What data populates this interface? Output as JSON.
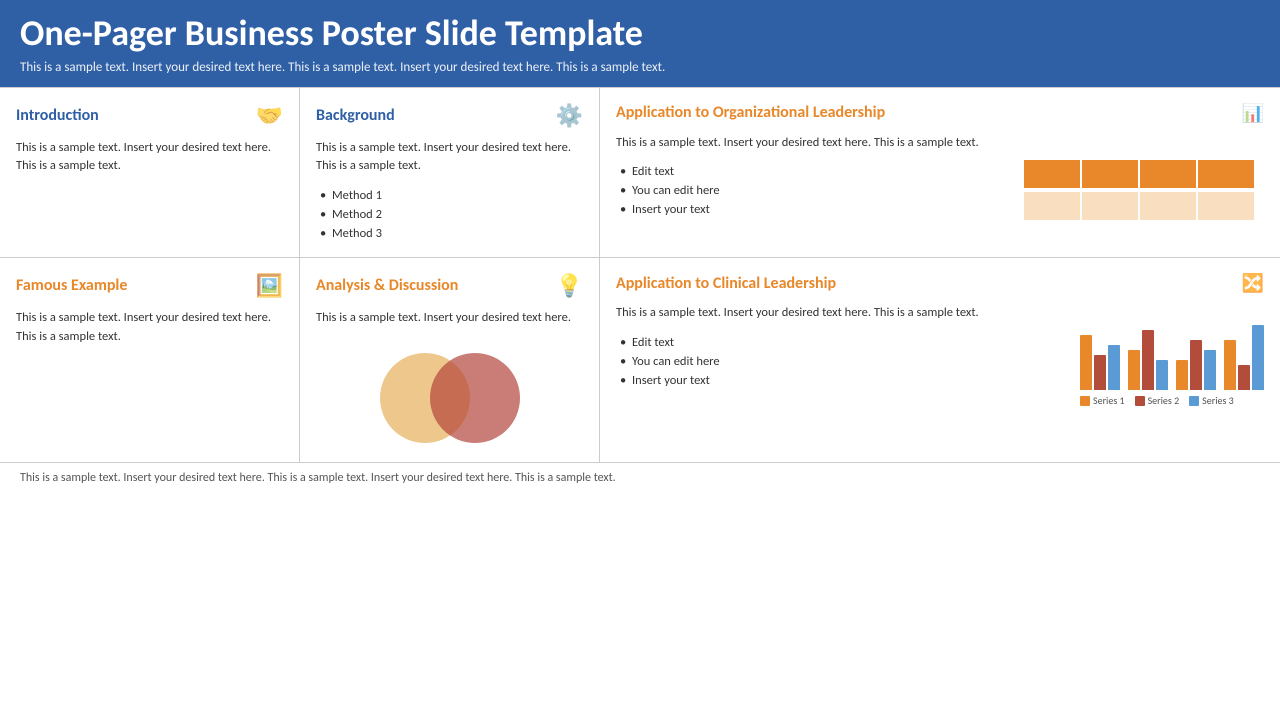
{
  "header": {
    "title": "One-Pager Business Poster Slide Template",
    "subtitle": "This is a sample text. Insert your desired text here. This is a sample text. Insert your desired text here. This is a sample text."
  },
  "footer": {
    "text": "This is a sample text. Insert your desired text here. This is a sample text. Insert your desired text here. This is a sample text."
  },
  "cells": {
    "introduction": {
      "title": "Introduction",
      "text": "This is a sample text. Insert your desired text here. This is a sample text.",
      "icon": "🤝"
    },
    "background": {
      "title": "Background",
      "text": "This is a sample text. Insert your desired text here. This is a sample text.",
      "icon": "⚙️",
      "bullets": [
        "Method 1",
        "Method 2",
        "Method 3"
      ]
    },
    "org_leadership": {
      "title": "Application to Organizational Leadership",
      "text": "This is a sample text. Insert your desired text here. This is a sample text.",
      "icon": "📊",
      "bullets": [
        "Edit text",
        "You can edit here",
        "Insert your text"
      ]
    },
    "famous_example": {
      "title": "Famous Example",
      "text": "This is a sample text. Insert your desired text here. This is a sample text.",
      "icon": "🖼️"
    },
    "analysis": {
      "title": "Analysis & Discussion",
      "text": "This is a sample text. Insert your desired text here.",
      "icon": "💡"
    },
    "clinical_leadership": {
      "title": "Application to Clinical Leadership",
      "text": "This is a sample text. Insert your desired text here. This is a sample text.",
      "icon": "🔀",
      "bullets": [
        "Edit text",
        "You can edit here",
        "Insert your text"
      ],
      "legend": [
        "Series 1",
        "Series 2",
        "Series 3"
      ]
    }
  },
  "colors": {
    "blue": "#2f5fa5",
    "orange": "#e8882a",
    "orange_light": "#f5c07a",
    "orange_pale": "#f9dfc0",
    "red_brown": "#b44c3c",
    "chart_blue": "#5b9bd5",
    "series1": "#e8882a",
    "series2": "#b44c3c",
    "series3": "#5b9bd5"
  }
}
